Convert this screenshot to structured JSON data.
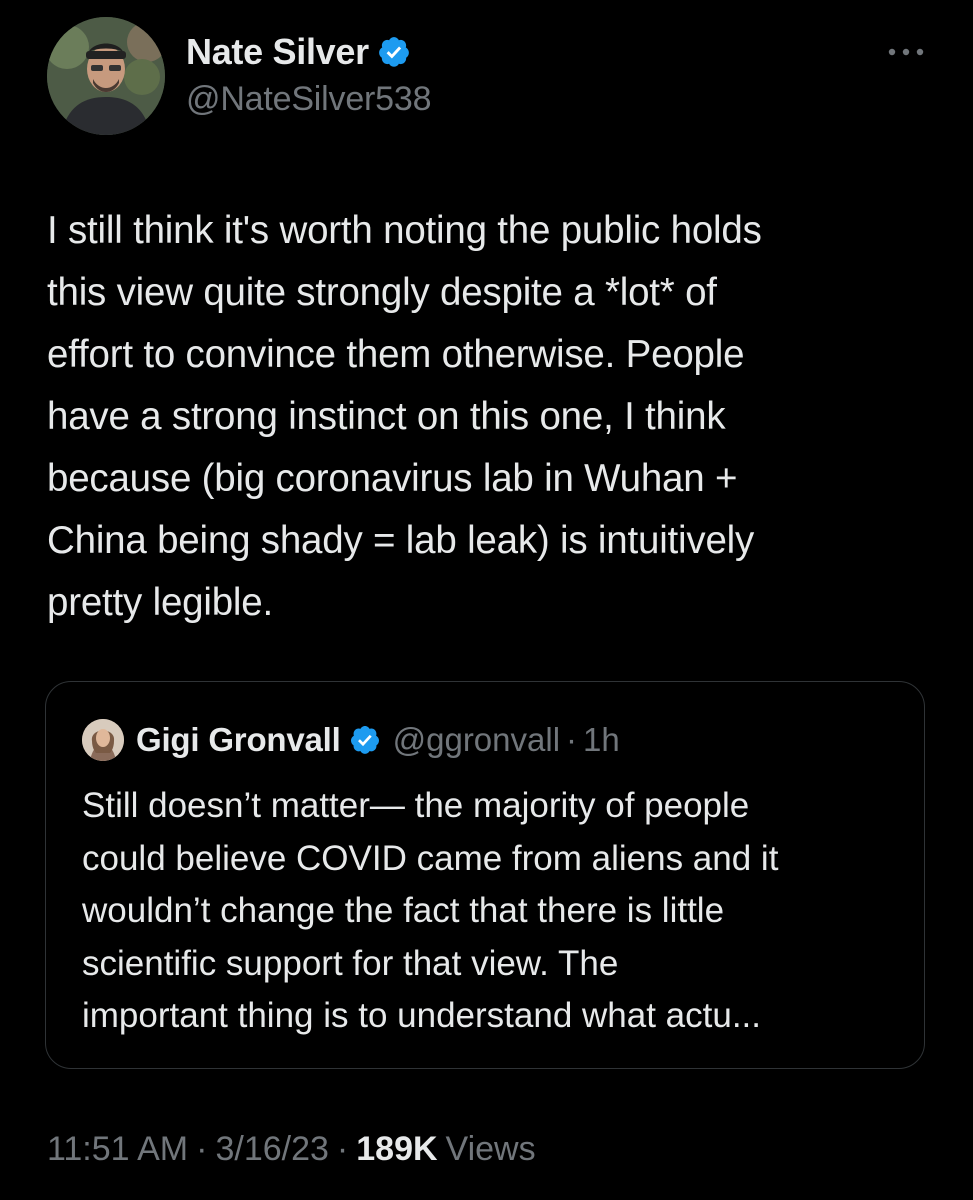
{
  "colors": {
    "background": "#000000",
    "text_primary": "#e7e9ea",
    "text_secondary": "#71767b",
    "verified_blue": "#1d9bf0",
    "border": "#2f3336"
  },
  "author": {
    "display_name": "Nate Silver",
    "handle": "@NateSilver538",
    "verified": true,
    "avatar_icon": "profile-photo"
  },
  "more_icon": "more-horizontal-icon",
  "tweet": {
    "lines": [
      "I still think it's worth noting the public holds",
      "this view quite strongly despite a *lot* of",
      "effort to convince them otherwise. People",
      "have a strong instinct on this one, I think",
      "because (big coronavirus lab in Wuhan +",
      "China being shady = lab leak) is intuitively",
      "pretty legible."
    ]
  },
  "quote": {
    "display_name": "Gigi Gronvall",
    "handle": "@ggronvall",
    "dot": "·",
    "time": "1h",
    "verified": true,
    "lines": [
      "Still doesn’t matter— the majority of people",
      "could believe COVID came from aliens and it",
      "wouldn’t change the fact that there is little",
      "scientific support for that view. The",
      "important thing is to understand what actu..."
    ]
  },
  "meta": {
    "time": "11:51 AM",
    "sep1": "·",
    "date": "3/16/23",
    "sep2": "·",
    "views_count": "189K",
    "views_label": "Views"
  }
}
